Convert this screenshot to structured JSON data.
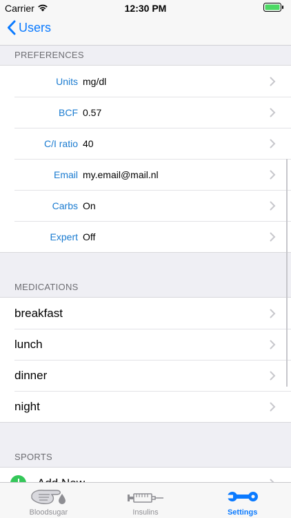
{
  "status_bar": {
    "carrier": "Carrier",
    "time": "12:30 PM"
  },
  "nav": {
    "back_label": "Users"
  },
  "sections": {
    "preferences": {
      "header": "PREFERENCES",
      "rows": [
        {
          "label": "Units",
          "value": "mg/dl"
        },
        {
          "label": "BCF",
          "value": "0.57"
        },
        {
          "label": "C/I ratio",
          "value": "40"
        },
        {
          "label": "Email",
          "value": "my.email@mail.nl"
        },
        {
          "label": "Carbs",
          "value": "On"
        },
        {
          "label": "Expert",
          "value": "Off"
        }
      ]
    },
    "medications": {
      "header": "MEDICATIONS",
      "items": [
        "breakfast",
        "lunch",
        "dinner",
        "night"
      ]
    },
    "sports": {
      "header": "SPORTS",
      "add_label": "Add New..."
    }
  },
  "tabs": [
    {
      "label": "Bloodsugar",
      "icon": "bloodsugar-icon"
    },
    {
      "label": "Insulins",
      "icon": "syringe-icon"
    },
    {
      "label": "Settings",
      "icon": "wrench-icon",
      "active": true
    }
  ],
  "colors": {
    "accent": "#0a7aff",
    "label_blue": "#1a7bd0",
    "add_green": "#34c759"
  }
}
